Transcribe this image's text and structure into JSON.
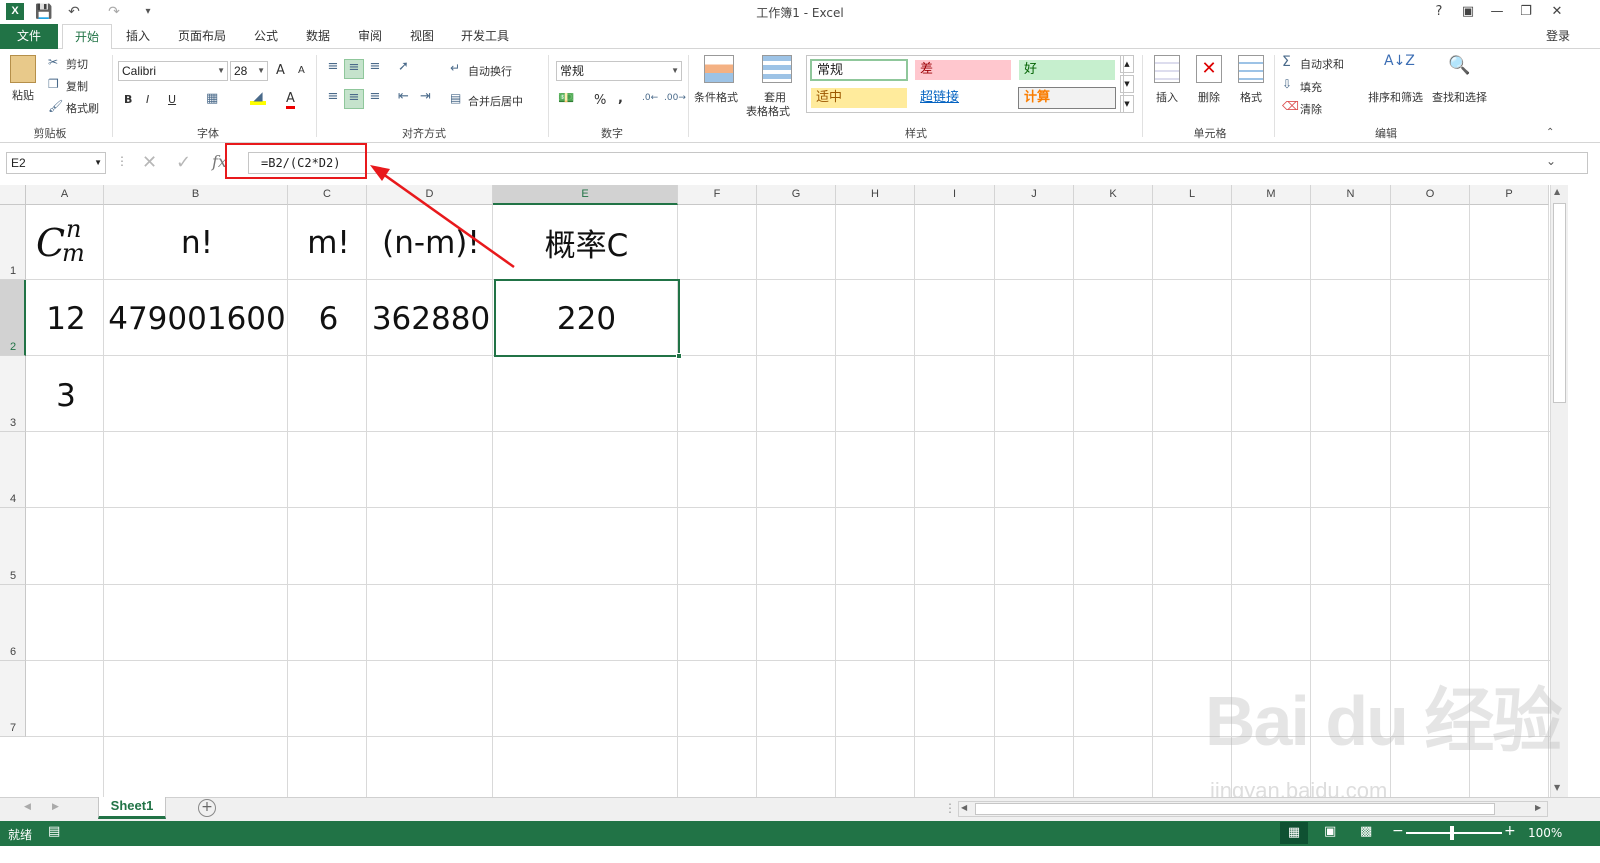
{
  "window": {
    "title": "工作簿1 - Excel",
    "help": "?",
    "login": "登录"
  },
  "tabs": [
    "文件",
    "开始",
    "插入",
    "页面布局",
    "公式",
    "数据",
    "审阅",
    "视图",
    "开发工具"
  ],
  "ribbon": {
    "clipboard": {
      "paste": "粘贴",
      "cut": "剪切",
      "copy": "复制",
      "format_painter": "格式刷",
      "label": "剪贴板"
    },
    "font": {
      "name": "Calibri",
      "size": "28",
      "bold": "B",
      "italic": "I",
      "underline": "U",
      "grow": "A",
      "shrink": "A",
      "font_color": "A",
      "label": "字体"
    },
    "alignment": {
      "wrap": "自动换行",
      "merge": "合并后居中",
      "label": "对齐方式"
    },
    "number": {
      "format": "常规",
      "percent": "%",
      "comma": ",",
      "label": "数字"
    },
    "styles": {
      "conditional": "条件格式",
      "table_format_1": "套用",
      "table_format_2": "表格格式",
      "normal": "常规",
      "bad": "差",
      "good": "好",
      "neutral": "适中",
      "hyperlink": "超链接",
      "calculation": "计算",
      "label": "样式"
    },
    "cells": {
      "insert": "插入",
      "delete": "删除",
      "format": "格式",
      "label": "单元格"
    },
    "editing": {
      "autosum": "自动求和",
      "fill": "填充",
      "clear": "清除",
      "sort": "排序和筛选",
      "find": "查找和选择",
      "label": "编辑"
    }
  },
  "formula_bar": {
    "name_box": "E2",
    "fx": "fx",
    "formula": "=B2/(C2*D2)"
  },
  "grid": {
    "columns": [
      "A",
      "B",
      "C",
      "D",
      "E",
      "F",
      "G",
      "H",
      "I",
      "J",
      "K",
      "L",
      "M",
      "N",
      "O",
      "P"
    ],
    "rows": [
      "1",
      "2",
      "3",
      "4",
      "5",
      "6",
      "7"
    ],
    "cells": {
      "A1_base": "C",
      "A1_sup": "n",
      "A1_sub": "m",
      "B1": "n!",
      "C1": "m!",
      "D1": "(n-m)!",
      "E1": "概率C",
      "A2": "12",
      "B2": "479001600",
      "C2": "6",
      "D2": "362880",
      "E2": "220",
      "A3": "3"
    }
  },
  "sheets": [
    "Sheet1"
  ],
  "status": {
    "ready": "就绪",
    "zoom": "100%"
  },
  "watermark": {
    "logo": "Bai du 经验",
    "url": "jingyan.baidu.com"
  },
  "colors": {
    "accent": "#217346",
    "annotation": "#e8191c"
  }
}
